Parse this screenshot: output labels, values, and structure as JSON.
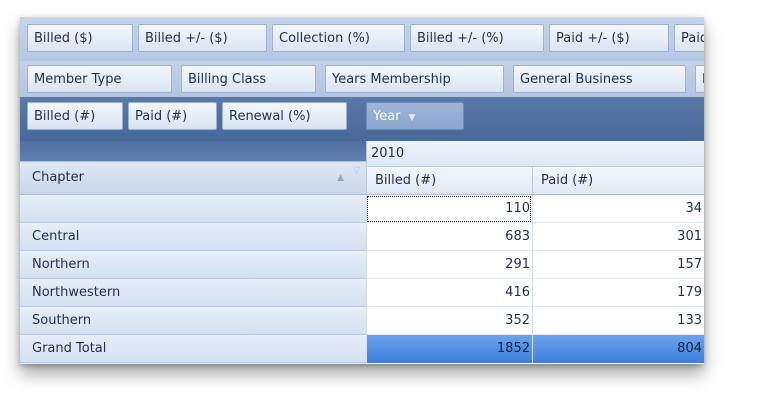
{
  "filter_row1": [
    "Billed ($)",
    "Billed +/- ($)",
    "Collection (%)",
    "Billed +/- (%)",
    "Paid +/- ($)",
    "Paid"
  ],
  "filter_row2": [
    "Member Type",
    "Billing Class",
    "Years Membership",
    "General Business",
    "F"
  ],
  "data_fields": [
    "Billed (#)",
    "Paid (#)",
    "Renewal (%)"
  ],
  "column_field": "Year",
  "row_field": "Chapter",
  "year": "2010",
  "columns": [
    "Billed (#)",
    "Paid (#)"
  ],
  "rows": [
    {
      "label": "",
      "billed": "110",
      "paid": "34"
    },
    {
      "label": "Central",
      "billed": "683",
      "paid": "301"
    },
    {
      "label": "Northern",
      "billed": "291",
      "paid": "157"
    },
    {
      "label": "Northwestern",
      "billed": "416",
      "paid": "179"
    },
    {
      "label": "Southern",
      "billed": "352",
      "paid": "133"
    },
    {
      "label": "Grand Total",
      "billed": "1852",
      "paid": "804"
    }
  ],
  "icons": {
    "column_field_dropdown": "chevron-down-icon",
    "sort": "sort-up-icon",
    "filter": "filter-icon"
  },
  "colors": {
    "header_band": "#4f6fa0",
    "total_highlight": "#4a8ae4",
    "panel": "#c1d2e8"
  }
}
